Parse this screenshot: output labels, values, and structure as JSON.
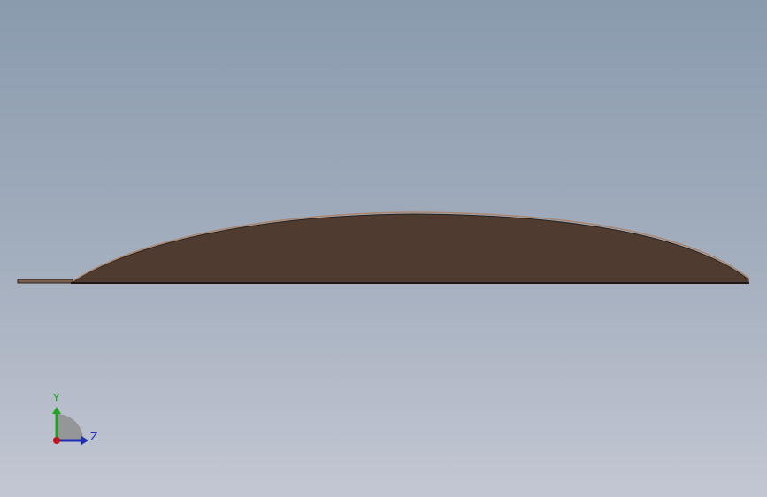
{
  "viewport": {
    "background_top": "#8a9bae",
    "background_bottom": "#c3c7d3"
  },
  "model": {
    "fill_color": "#4f3b2f",
    "edge_color": "#2a201a",
    "highlight_color": "#9a7a66"
  },
  "triad": {
    "y_label": "Y",
    "z_label": "Z",
    "y_color": "#1fa31f",
    "z_color": "#1f2fb5",
    "x_color": "#c0141a"
  }
}
